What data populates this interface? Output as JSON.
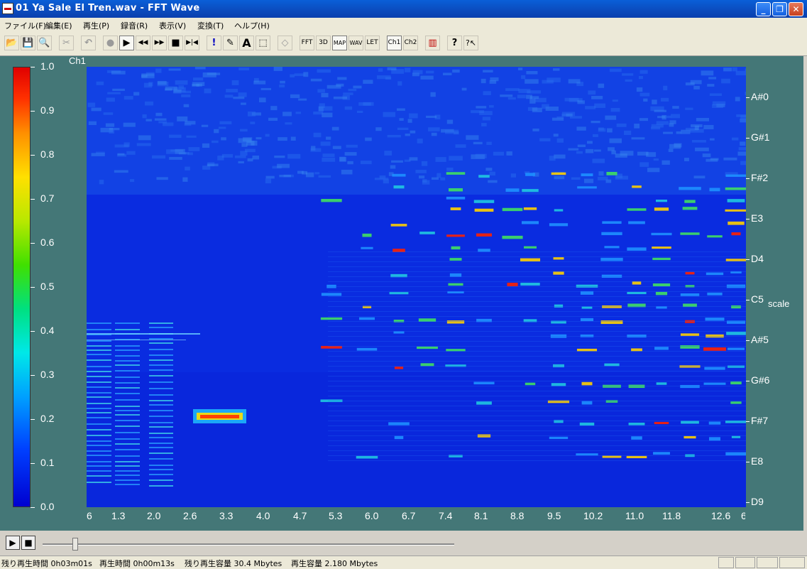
{
  "window": {
    "title": "01 Ya Sale El Tren.wav - FFT Wave"
  },
  "titlebar_buttons": {
    "minimize": "_",
    "maximize": "❐",
    "close": "✕"
  },
  "menu": [
    "ファイル(F)",
    "編集(E)",
    "再生(P)",
    "録音(R)",
    "表示(V)",
    "変換(T)",
    "ヘルプ(H)"
  ],
  "toolbar": {
    "open": "📂",
    "save": "💾",
    "preview": "🔍",
    "cut": "✂",
    "undo": "↶",
    "record": "●",
    "play": "▶",
    "rewind": "◀◀",
    "forward": "▶▶",
    "stop": "■",
    "end": "▶|◀",
    "marker": "!",
    "pencil": "✎",
    "text": "A",
    "select": "⬚",
    "eraser": "◇",
    "fft": "FFT",
    "three_d": "3D",
    "map": "MAP",
    "wav": "WAV",
    "let": "LET",
    "ch1": "Ch1",
    "ch2": "Ch2",
    "colors": "▥",
    "help": "?",
    "context_help": "?↖"
  },
  "channel_label": "Ch1",
  "colorbar": {
    "ticks": [
      "1.0",
      "0.9",
      "0.8",
      "0.7",
      "0.6",
      "0.5",
      "0.4",
      "0.3",
      "0.2",
      "0.1",
      "0.0"
    ]
  },
  "x_axis": {
    "ticks": [
      "6",
      "1.3",
      "2.0",
      "2.6",
      "3.3",
      "4.0",
      "4.7",
      "5.3",
      "6.0",
      "6.7",
      "7.4",
      "8.1",
      "8.8",
      "9.5",
      "10.2",
      "11.0",
      "11.8",
      "12.6"
    ],
    "partial_tick": "6"
  },
  "y_axis": {
    "label": "scale",
    "ticks": [
      "A#0",
      "G#1",
      "F#2",
      "E3",
      "D4",
      "C5",
      "A#5",
      "G#6",
      "F#7",
      "E8",
      "D9"
    ]
  },
  "playback": {
    "play": "▶",
    "stop": "■",
    "position": 0.08
  },
  "status": {
    "remaining_time": "残り再生時間 0h03m01s",
    "play_time": "再生時間 0h00m13s",
    "remaining_capacity": "残り再生容量 30.4 Mbytes",
    "play_capacity": "再生容量 2.180 Mbytes"
  },
  "colors": {
    "background": "#447777",
    "spectrogram_base": "#0d2fe0"
  }
}
